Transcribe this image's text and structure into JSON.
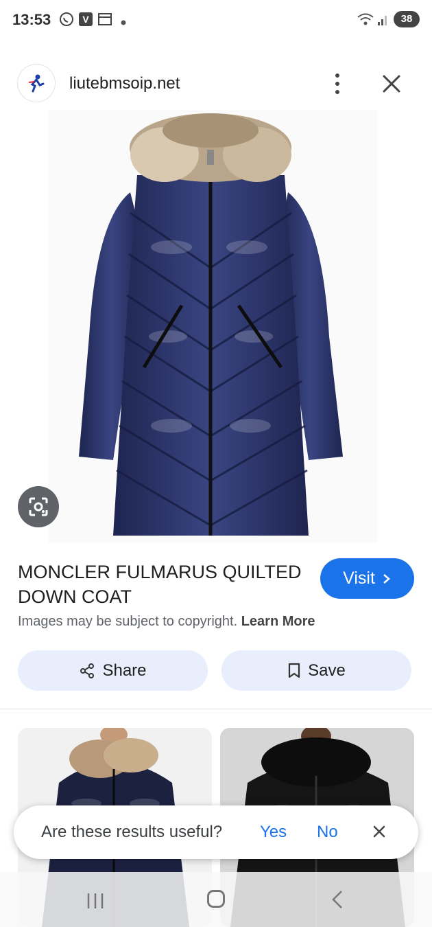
{
  "status_bar": {
    "time": "13:53",
    "battery": "38",
    "icons": [
      "whatsapp-icon",
      "v-app-icon",
      "calendar-icon",
      "dot-icon",
      "wifi-icon",
      "signal-icon"
    ]
  },
  "header": {
    "site_name": "liutebmsoip.net",
    "favicon": "runner-logo-icon"
  },
  "product": {
    "title": "MONCLER FULMARUS QUILTED DOWN COAT",
    "visit_label": "Visit",
    "copyright_text": "Images may be subject to copyright.",
    "learn_more": "Learn More"
  },
  "actions": {
    "share_label": "Share",
    "save_label": "Save"
  },
  "feedback": {
    "question": "Are these results useful?",
    "yes_label": "Yes",
    "no_label": "No"
  },
  "colors": {
    "accent": "#1a73e8",
    "coat": "#2c3566",
    "button_bg": "#e8eefb"
  }
}
